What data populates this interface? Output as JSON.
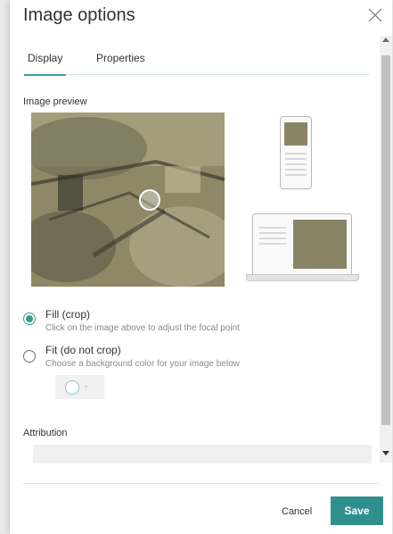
{
  "dialog": {
    "title": "Image options"
  },
  "tabs": [
    {
      "label": "Display",
      "active": true
    },
    {
      "label": "Properties",
      "active": false
    }
  ],
  "preview": {
    "label": "Image preview"
  },
  "options": {
    "fill": {
      "label": "Fill (crop)",
      "description": "Click on the image above to adjust the focal point",
      "selected": true
    },
    "fit": {
      "label": "Fit (do not crop)",
      "description": "Choose a background color for your image below",
      "selected": false
    },
    "color_chevron": "⌄"
  },
  "attribution": {
    "label": "Attribution",
    "value": ""
  },
  "footer": {
    "cancel_label": "Cancel",
    "save_label": "Save"
  },
  "colors": {
    "accent": "#3a9b98",
    "save_bg": "#2f8f8d"
  },
  "icons": {
    "close": "close-icon",
    "scroll_up": "scroll-up-icon",
    "scroll_down": "scroll-down-icon",
    "chevron": "chevron-down-icon"
  }
}
